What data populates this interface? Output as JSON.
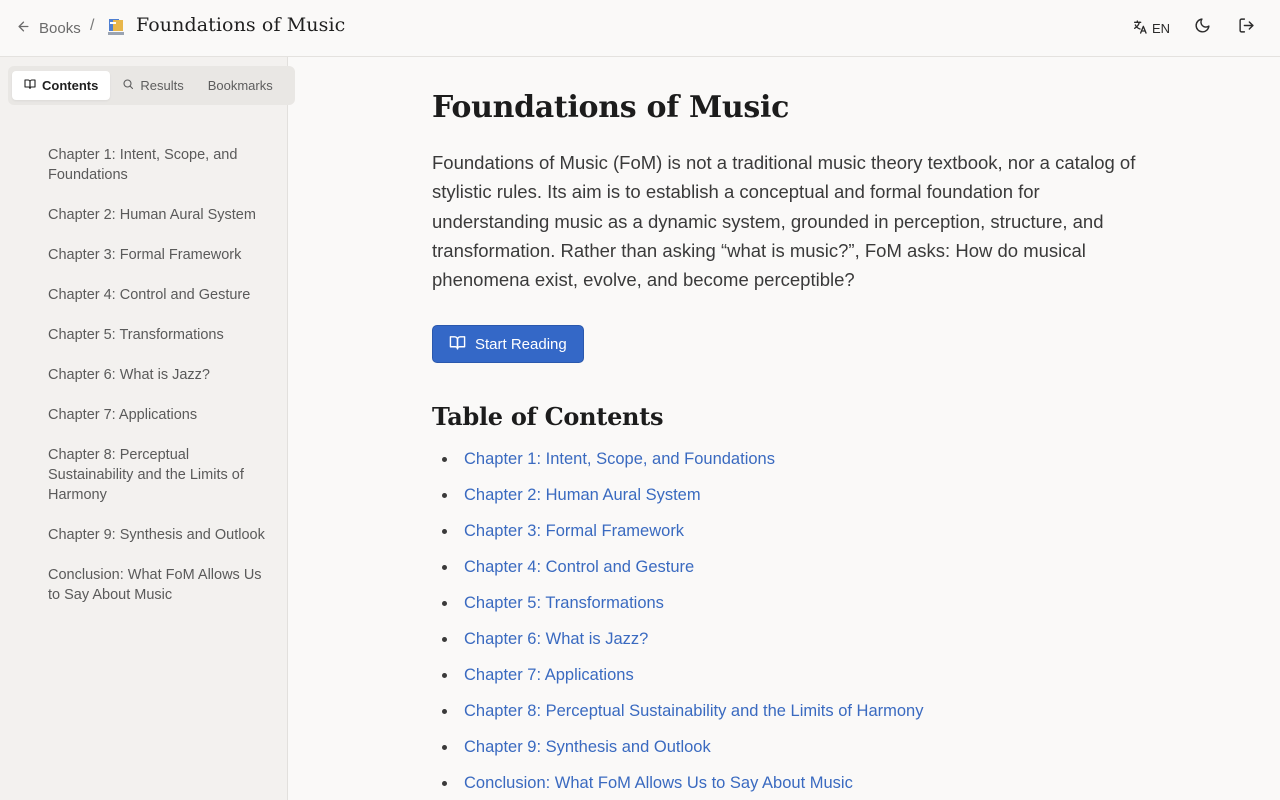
{
  "header": {
    "back_label": "Books",
    "separator": "/",
    "title": "Foundations of Music",
    "language": "EN",
    "icons": {
      "back": "arrow-left-icon",
      "book_logo": "book-logo-icon",
      "language": "translate-icon",
      "theme": "moon-icon",
      "logout": "logout-icon"
    }
  },
  "sidebar": {
    "tabs": [
      {
        "label": "Contents",
        "icon": "book-open-icon",
        "active": true
      },
      {
        "label": "Results",
        "icon": "search-icon",
        "active": false
      },
      {
        "label": "Bookmarks",
        "icon": "",
        "active": false
      }
    ],
    "items": [
      "Chapter 1: Intent, Scope, and Foundations",
      "Chapter 2: Human Aural System",
      "Chapter 3: Formal Framework",
      "Chapter 4: Control and Gesture",
      "Chapter 5: Transformations",
      "Chapter 6: What is Jazz?",
      "Chapter 7: Applications",
      "Chapter 8: Perceptual Sustainability and the Limits of Harmony",
      "Chapter 9: Synthesis and Outlook",
      "Conclusion: What FoM Allows Us to Say About Music"
    ]
  },
  "main": {
    "title": "Foundations of Music",
    "intro": "Foundations of Music (FoM) is not a traditional music theory textbook, nor a catalog of stylistic rules. Its aim is to establish a conceptual and formal foundation for understanding music as a dynamic system, grounded in perception, structure, and transformation. Rather than asking “what is music?”, FoM asks: How do musical phenomena exist, evolve, and become perceptible?",
    "start_button": "Start Reading",
    "toc_heading": "Table of Contents",
    "toc": [
      "Chapter 1: Intent, Scope, and Foundations",
      "Chapter 2: Human Aural System",
      "Chapter 3: Formal Framework",
      "Chapter 4: Control and Gesture",
      "Chapter 5: Transformations",
      "Chapter 6: What is Jazz?",
      "Chapter 7: Applications",
      "Chapter 8: Perceptual Sustainability and the Limits of Harmony",
      "Chapter 9: Synthesis and Outlook",
      "Conclusion: What FoM Allows Us to Say About Music"
    ]
  },
  "colors": {
    "accent": "#3468c7",
    "link": "#3a6ac0",
    "sidebar_bg": "#f3f1ef",
    "page_bg": "#faf9f8"
  }
}
